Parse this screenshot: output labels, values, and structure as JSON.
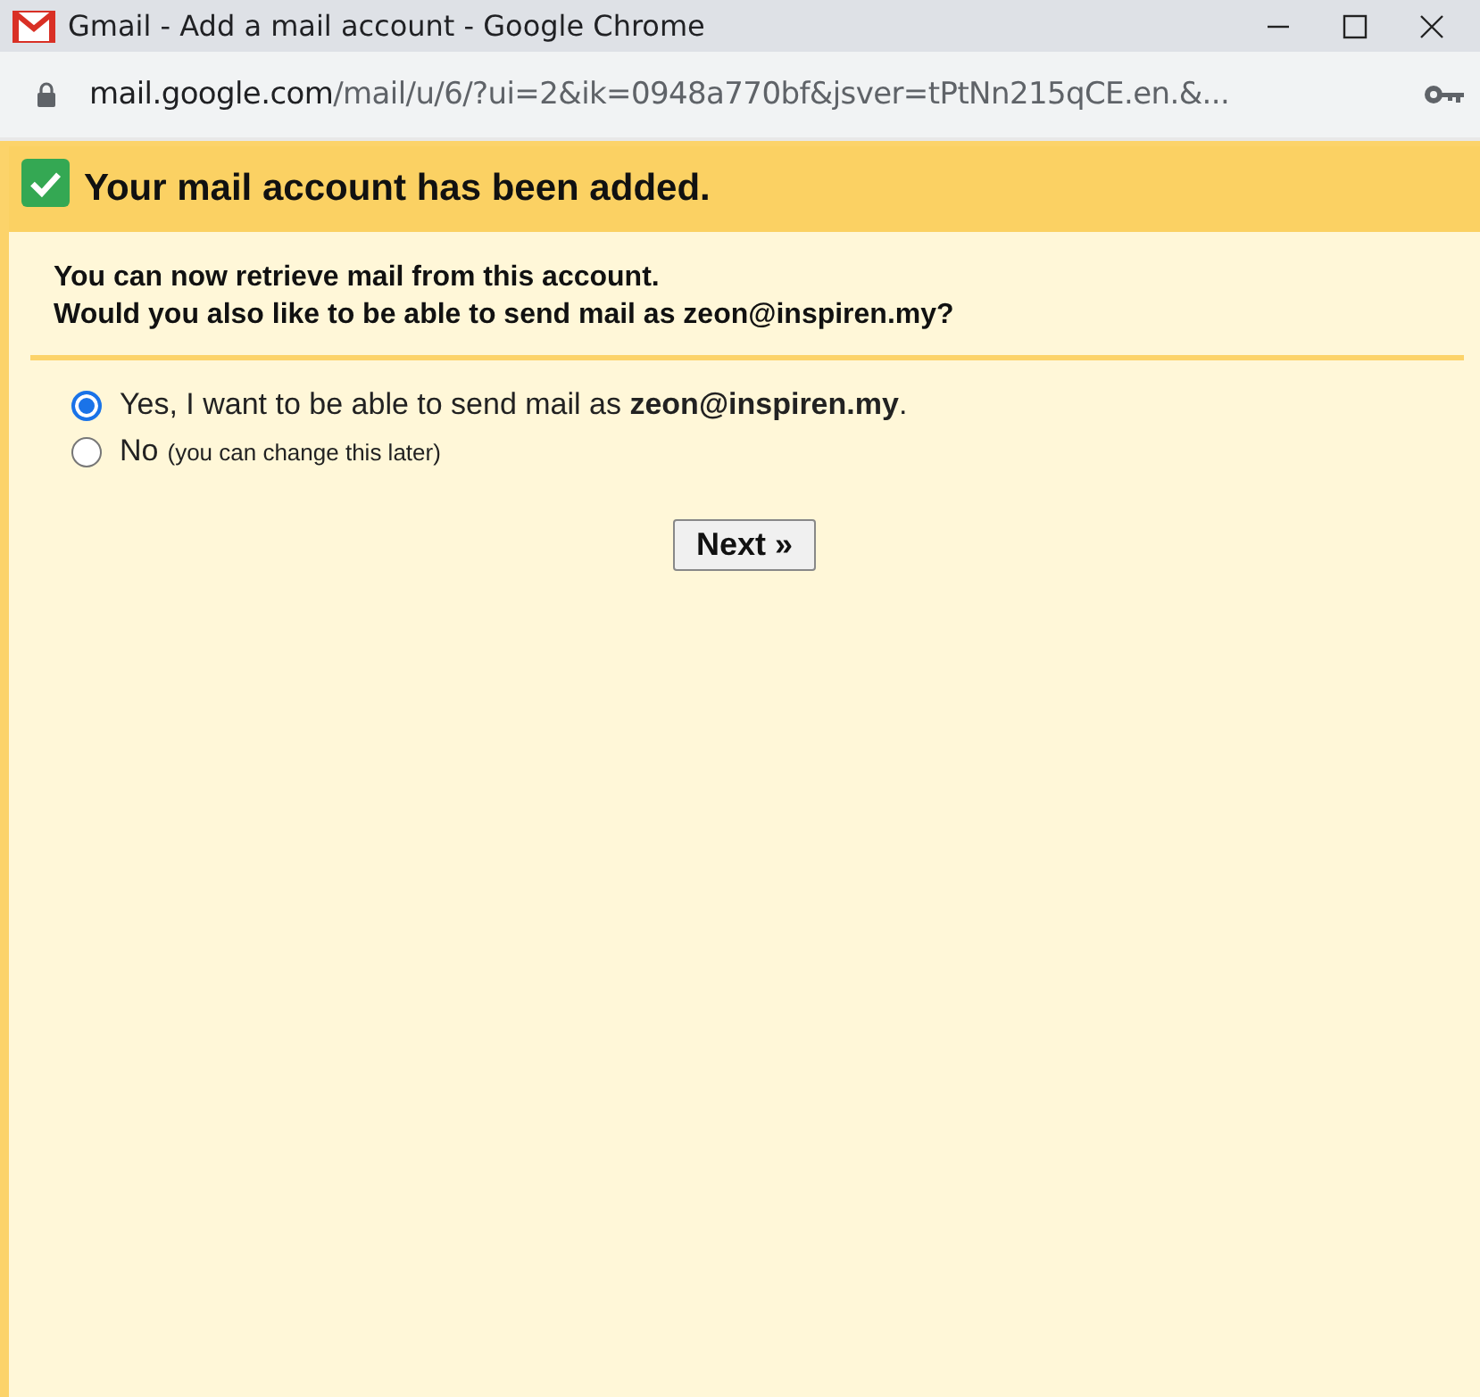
{
  "window": {
    "title": "Gmail - Add a mail account - Google Chrome"
  },
  "address_bar": {
    "host": "mail.google.com",
    "path": "/mail/u/6/?ui=2&ik=0948a770bf&jsver=tPtNn215qCE.en.&..."
  },
  "header": {
    "title": "Your mail account has been added."
  },
  "message": [
    "You can now retrieve mail from this account.",
    "Would you also like to be able to send mail as zeon@inspiren.my?"
  ],
  "options": [
    {
      "label": "Yes, I want to be able to send mail as **zeon@inspiren.my**.",
      "selected": true
    },
    {
      "label": "No",
      "note": "(you can change this later)",
      "selected": false
    }
  ],
  "buttons": [
    "Next »"
  ]
}
